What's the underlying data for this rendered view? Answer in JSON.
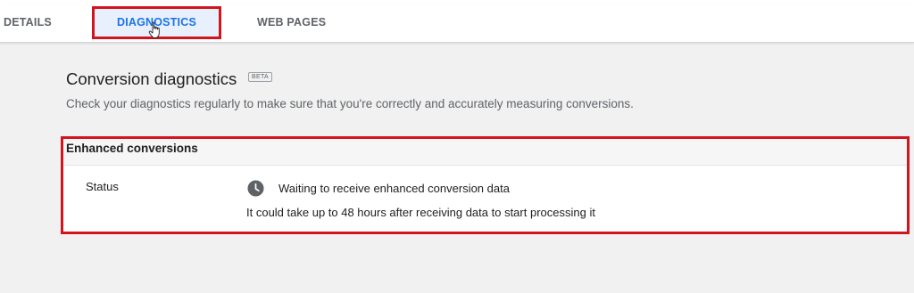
{
  "tabs": [
    {
      "label": "DETAILS",
      "active": false
    },
    {
      "label": "DIAGNOSTICS",
      "active": true
    },
    {
      "label": "WEB PAGES",
      "active": false
    }
  ],
  "header": {
    "title": "Conversion diagnostics",
    "badge": "BETA",
    "description": "Check your diagnostics regularly to make sure that you're correctly and accurately measuring conversions."
  },
  "enhanced_conversions": {
    "title": "Enhanced conversions",
    "status_label": "Status",
    "status_icon": "clock-icon",
    "status_value": "Waiting to receive enhanced conversion data",
    "status_note": "It could take up to 48 hours after receiving data to start processing it"
  },
  "colors": {
    "highlight": "#d3141c",
    "active_tab_text": "#1a73e8",
    "active_tab_bg": "#e8f0fe"
  }
}
